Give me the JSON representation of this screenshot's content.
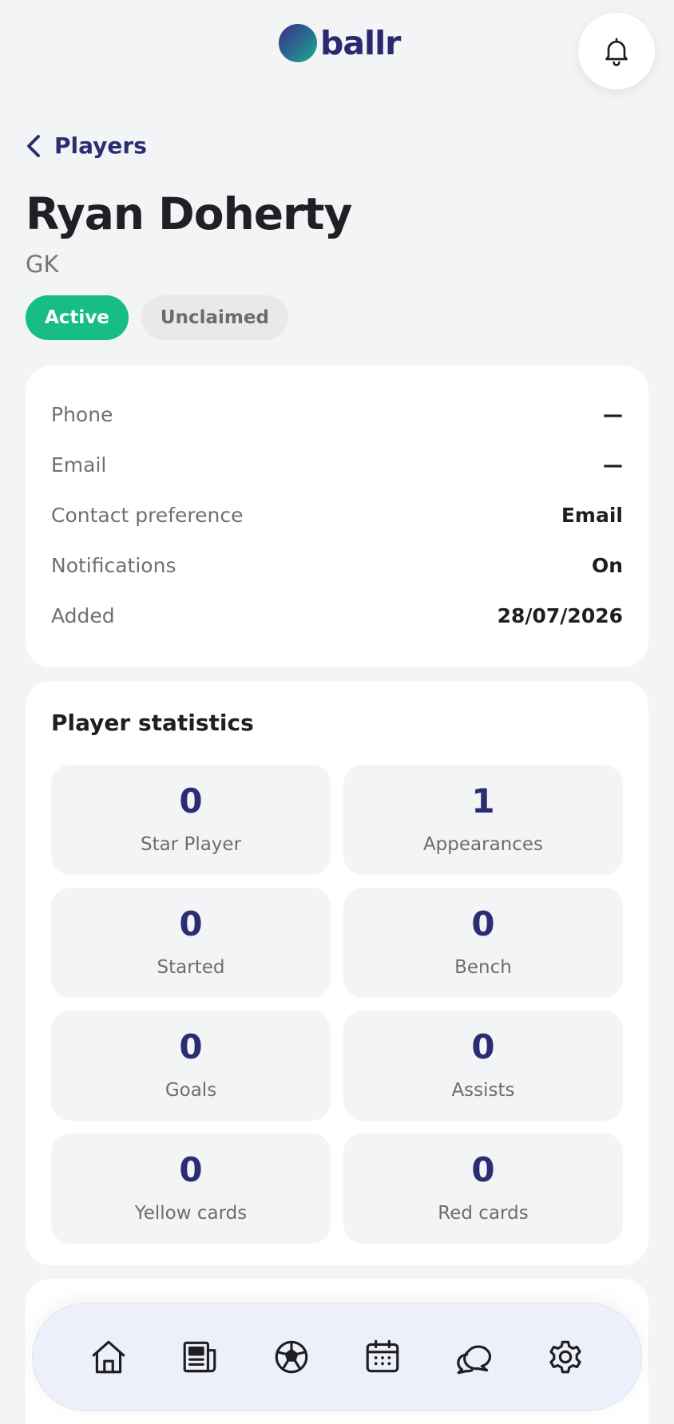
{
  "header": {
    "logo_text": "ballr"
  },
  "nav_back": {
    "label": "Players"
  },
  "player": {
    "name": "Ryan Doherty",
    "position": "GK",
    "status_badge": "Active",
    "claim_badge": "Unclaimed"
  },
  "info": {
    "rows": [
      {
        "label": "Phone",
        "value": "—"
      },
      {
        "label": "Email",
        "value": "—"
      },
      {
        "label": "Contact preference",
        "value": "Email"
      },
      {
        "label": "Notifications",
        "value": "On"
      },
      {
        "label": "Added",
        "value": "28/07/2026"
      }
    ]
  },
  "stats": {
    "title": "Player statistics",
    "tiles": [
      {
        "value": "0",
        "label": "Star Player"
      },
      {
        "value": "1",
        "label": "Appearances"
      },
      {
        "value": "0",
        "label": "Started"
      },
      {
        "value": "0",
        "label": "Bench"
      },
      {
        "value": "0",
        "label": "Goals"
      },
      {
        "value": "0",
        "label": "Assists"
      },
      {
        "value": "0",
        "label": "Yellow cards"
      },
      {
        "value": "0",
        "label": "Red cards"
      }
    ]
  },
  "bottom_nav": {
    "items": [
      {
        "icon": "home-icon"
      },
      {
        "icon": "news-icon"
      },
      {
        "icon": "football-icon"
      },
      {
        "icon": "calendar-icon"
      },
      {
        "icon": "chat-icon"
      },
      {
        "icon": "settings-icon"
      }
    ]
  },
  "colors": {
    "brand_navy": "#2b2d72",
    "active_green": "#17bd85",
    "background": "#f3f4f6"
  }
}
